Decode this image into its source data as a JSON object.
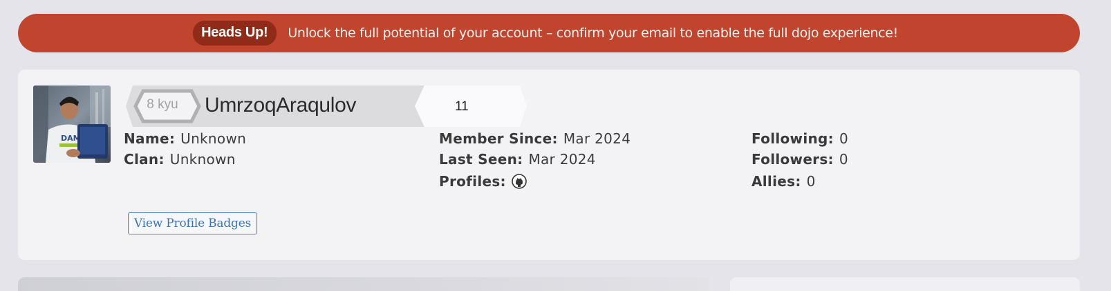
{
  "alert": {
    "badge": "Heads Up!",
    "message": "Unlock the full potential of your account – confirm your email to enable the full dojo experience!"
  },
  "profile": {
    "rank": "8 kyu",
    "username": "UmrzoqAraqulov",
    "honor": "11",
    "stats": {
      "name_label": "Name:",
      "name_value": "Unknown",
      "clan_label": "Clan:",
      "clan_value": "Unknown",
      "member_since_label": "Member Since:",
      "member_since_value": "Mar 2024",
      "last_seen_label": "Last Seen:",
      "last_seen_value": "Mar 2024",
      "profiles_label": "Profiles:",
      "profiles_icon": "github-icon",
      "following_label": "Following:",
      "following_value": "0",
      "followers_label": "Followers:",
      "followers_value": "0",
      "allies_label": "Allies:",
      "allies_value": "0"
    },
    "badges_button": "View Profile Badges"
  },
  "colors": {
    "alert_bg": "#c0442e",
    "alert_badge_bg": "#8f2b18",
    "card_bg": "#f3f3f6",
    "page_bg": "#e4e4ea",
    "link_blue": "#3f72b8"
  }
}
